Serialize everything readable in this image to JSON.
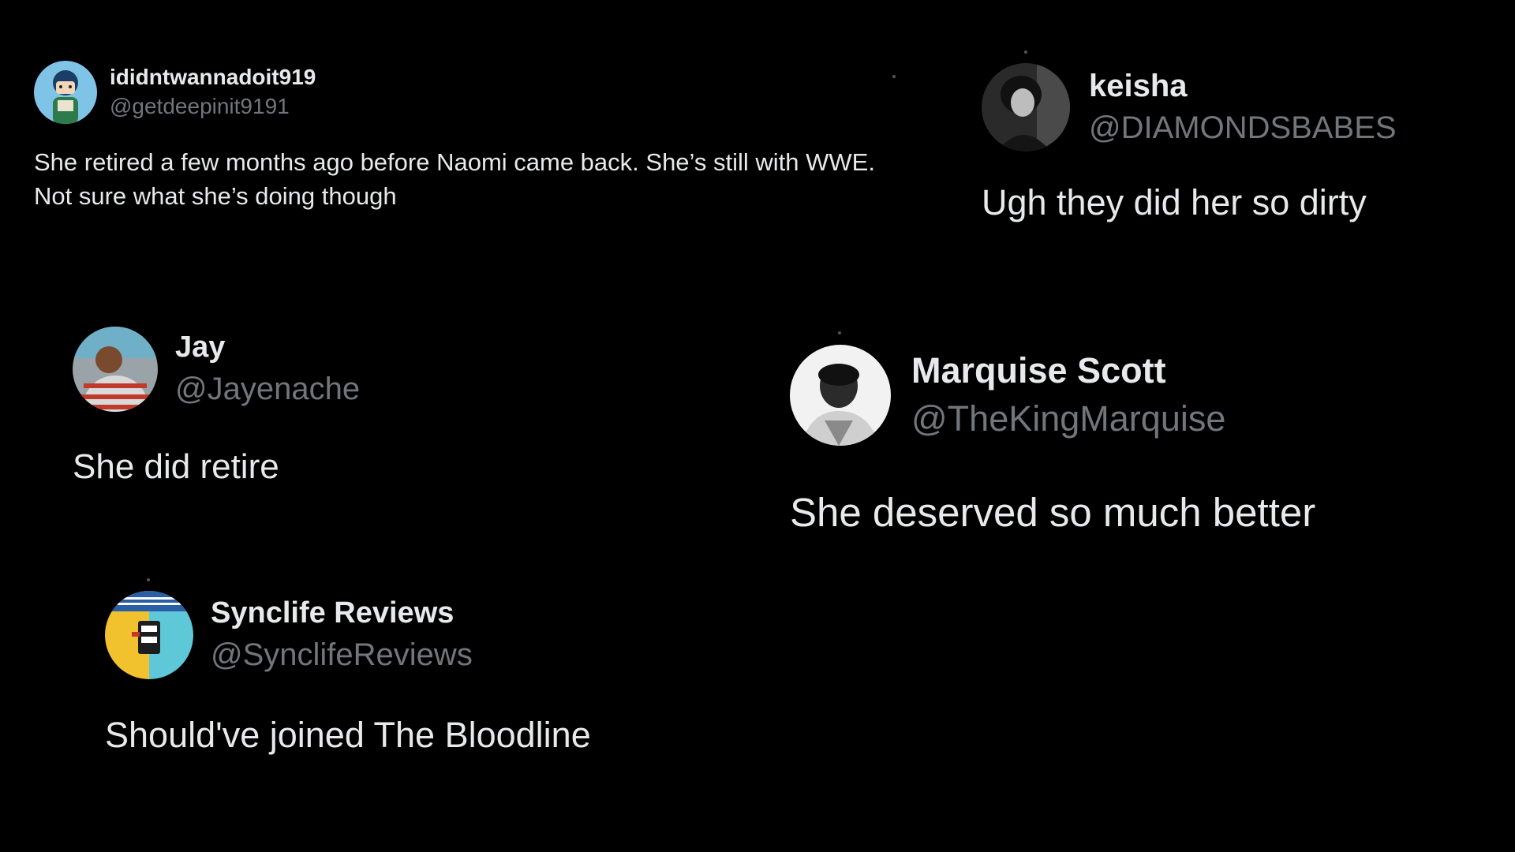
{
  "background_color": "#000000",
  "text_color": "#e7e9ea",
  "handle_color": "#71767b",
  "posts": [
    {
      "display_name": "ididntwannadoit919",
      "handle": "@getdeepinit9191",
      "text": "She retired a few months ago before Naomi came back. She’s still with WWE. Not sure what she’s doing though",
      "avatar": "cartoon-avatar-icon"
    },
    {
      "display_name": "keisha",
      "handle": "@DIAMONDSBABES",
      "text": "Ugh they did her so dirty",
      "avatar": "black-and-white-portrait-photo"
    },
    {
      "display_name": "Jay",
      "handle": "@Jayenache",
      "text": "She did retire",
      "avatar": "profile-photo"
    },
    {
      "display_name": "Marquise Scott",
      "handle": "@TheKingMarquise",
      "text": "She deserved so much better",
      "avatar": "black-and-white-portrait-photo"
    },
    {
      "display_name": "Synclife Reviews",
      "handle": "@SynclifeReviews",
      "text": "Should've joined The Bloodline",
      "avatar": "synclife-logo-icon"
    }
  ]
}
